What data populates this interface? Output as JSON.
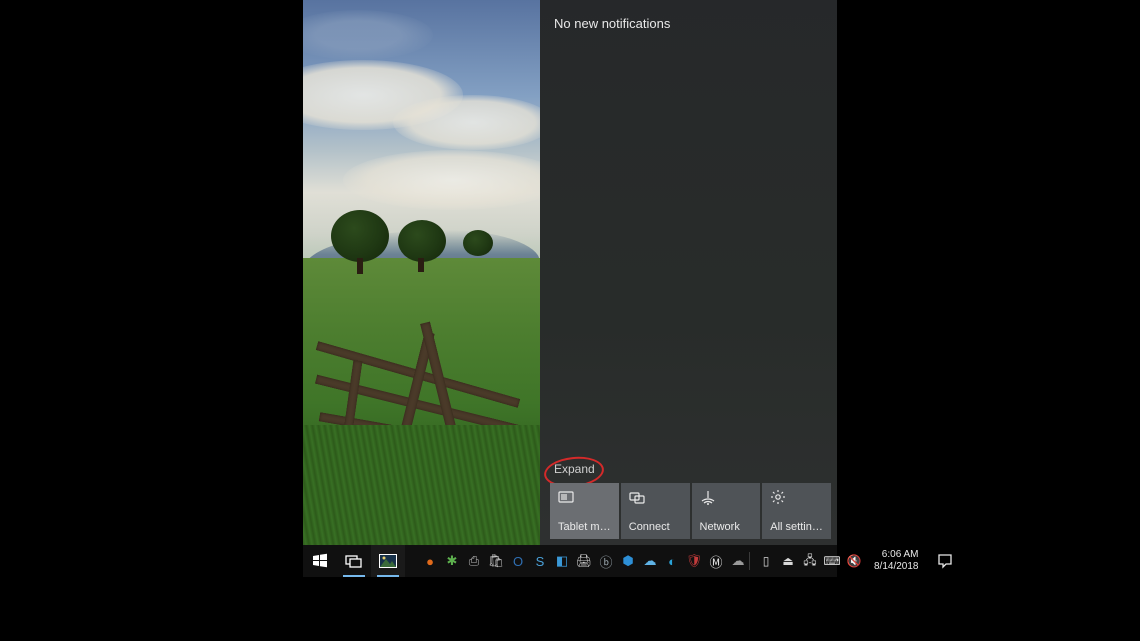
{
  "action_center": {
    "header": "No new notifications",
    "expand_label": "Expand",
    "quick_actions": [
      {
        "id": "tablet-mode",
        "label": "Tablet mode",
        "active": true
      },
      {
        "id": "connect",
        "label": "Connect",
        "active": false
      },
      {
        "id": "network",
        "label": "Network",
        "active": false
      },
      {
        "id": "all-settings",
        "label": "All settings",
        "active": false
      }
    ]
  },
  "taskbar": {
    "pinned": [
      {
        "id": "start",
        "icon": "windows-logo",
        "running": false
      },
      {
        "id": "task-view",
        "icon": "task-view",
        "running": true
      },
      {
        "id": "photos",
        "icon": "photos",
        "running": true
      }
    ],
    "tray_apps": [
      {
        "id": "app1",
        "color": "#e06a1b",
        "glyph": "●"
      },
      {
        "id": "app2",
        "color": "#5db04e",
        "glyph": "✱"
      },
      {
        "id": "app3",
        "color": "#b9b9b9",
        "glyph": "⎙"
      },
      {
        "id": "app4",
        "color": "#c7c7c7",
        "glyph": "🛍"
      },
      {
        "id": "app5",
        "color": "#2f6fb3",
        "glyph": "O"
      },
      {
        "id": "app6",
        "color": "#4aa0d8",
        "glyph": "S"
      },
      {
        "id": "app7",
        "color": "#3a99d8",
        "glyph": "◧"
      },
      {
        "id": "app8",
        "color": "#cfcfcf",
        "glyph": "🖨"
      },
      {
        "id": "app9",
        "color": "#9aa6ad",
        "glyph": "ⓑ"
      },
      {
        "id": "app10",
        "color": "#2d8fd6",
        "glyph": "⬢"
      },
      {
        "id": "app11",
        "color": "#5fb3e6",
        "glyph": "☁"
      },
      {
        "id": "app12",
        "color": "#2aa3d8",
        "glyph": "◐"
      },
      {
        "id": "app13",
        "color": "#c23b3b",
        "glyph": "🛡"
      },
      {
        "id": "app14",
        "color": "#e8e8e8",
        "glyph": "Ⓜ"
      },
      {
        "id": "app15",
        "color": "#9a9a9a",
        "glyph": "☁"
      }
    ],
    "system_tray": [
      {
        "id": "battery",
        "glyph": "▯"
      },
      {
        "id": "hardware",
        "glyph": "⏏"
      },
      {
        "id": "network",
        "glyph": "🖧"
      },
      {
        "id": "input",
        "glyph": "⌨"
      },
      {
        "id": "volume",
        "glyph": "🔇"
      }
    ],
    "clock": {
      "time": "6:06 AM",
      "date": "8/14/2018"
    }
  },
  "annotation": {
    "circle_color": "#d42a2a"
  }
}
